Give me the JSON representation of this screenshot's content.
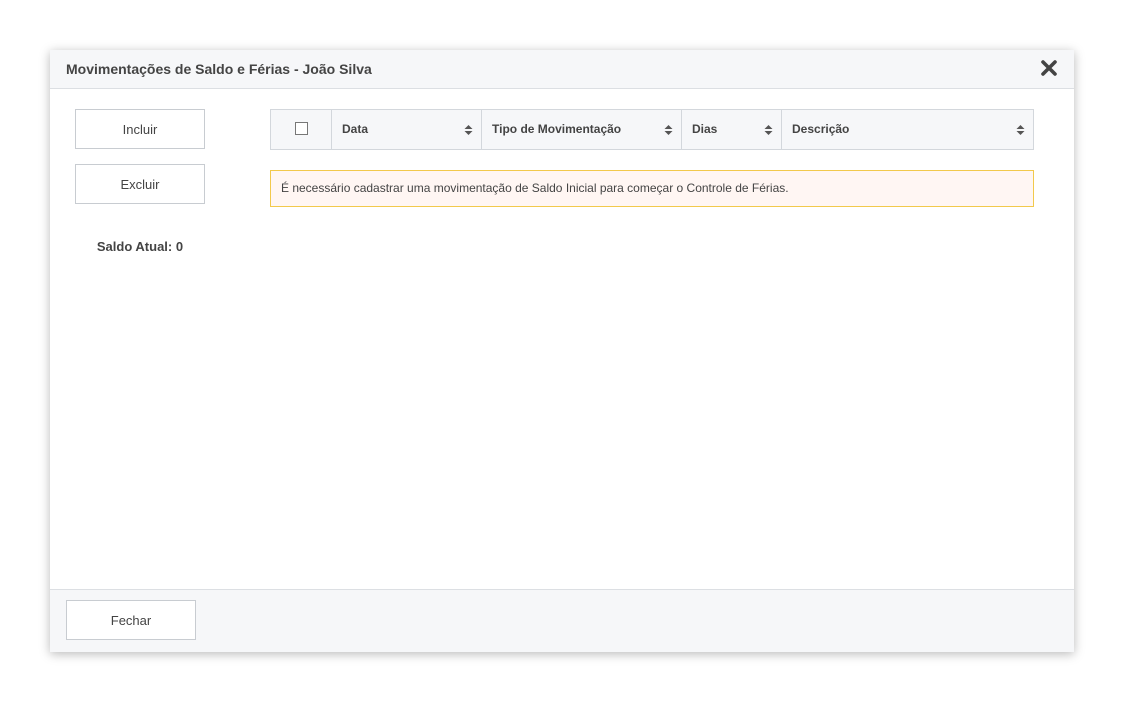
{
  "modal": {
    "title": "Movimentações de Saldo e Férias - João Silva",
    "close_icon": "close-x-icon"
  },
  "sidebar": {
    "include_label": "Incluir",
    "delete_label": "Excluir",
    "balance_text": "Saldo Atual: 0"
  },
  "grid": {
    "columns": [
      {
        "label": "",
        "type": "checkbox"
      },
      {
        "label": "Data",
        "sortable": true
      },
      {
        "label": "Tipo de Movimentação",
        "sortable": true
      },
      {
        "label": "Dias",
        "sortable": true
      },
      {
        "label": "Descrição",
        "sortable": true
      }
    ],
    "rows": [],
    "empty_message": "É necessário cadastrar uma movimentação de Saldo Inicial para começar o Controle de Férias."
  },
  "footer": {
    "close_label": "Fechar"
  },
  "colors": {
    "header_bg": "#f6f7f9",
    "border": "#d3d7dc",
    "alert_border": "#f2c94c",
    "alert_bg": "#fff6f3",
    "text": "#444444"
  }
}
